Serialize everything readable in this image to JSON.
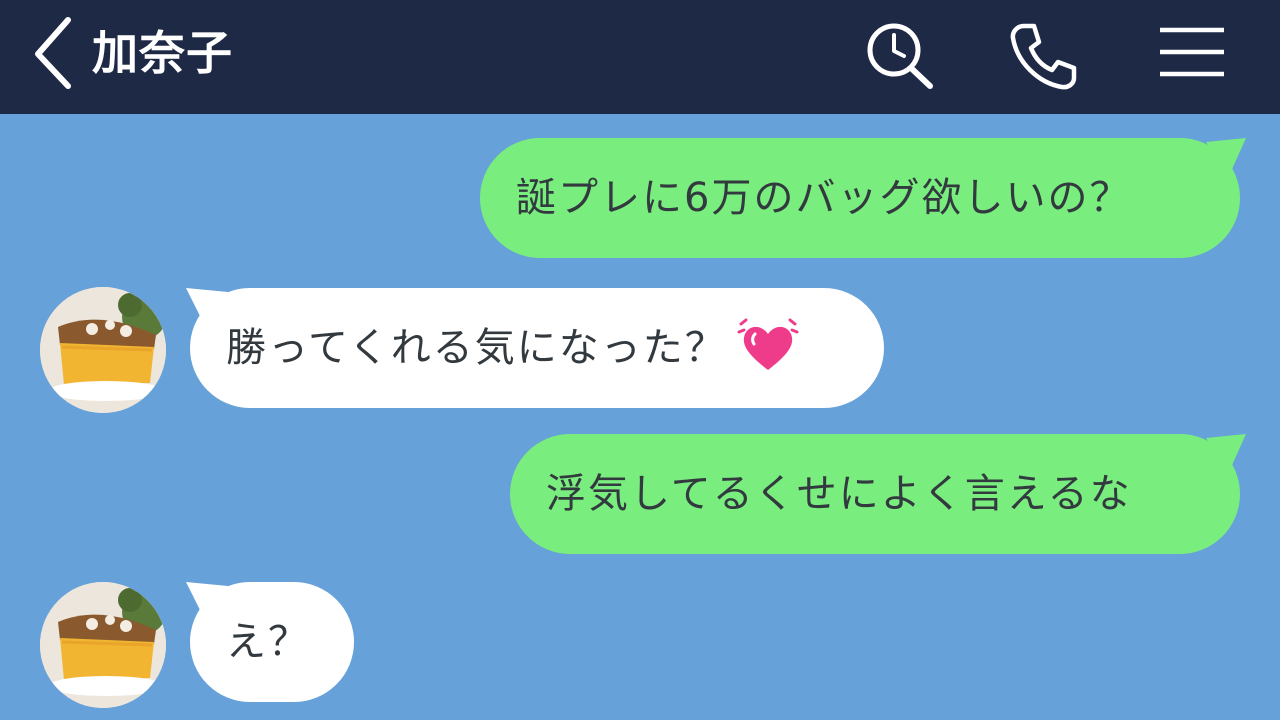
{
  "header": {
    "title": "加奈子",
    "icons": [
      "back-chevron-icon",
      "search-history-icon",
      "phone-icon",
      "hamburger-menu-icon"
    ]
  },
  "colors": {
    "header_bg": "#1e2946",
    "chat_bg": "#66a1d9",
    "sent_bubble": "#79ed7e",
    "received_bubble": "#ffffff",
    "text": "#333a3f"
  },
  "messages": [
    {
      "direction": "sent",
      "text": "誕プレに6万のバッグ欲しいの？"
    },
    {
      "direction": "received",
      "text": "勝ってくれる気になった？",
      "emoji": "heart-emoji"
    },
    {
      "direction": "sent",
      "text": "浮気してるくせによく言えるな"
    },
    {
      "direction": "received",
      "text": "え？"
    }
  ]
}
